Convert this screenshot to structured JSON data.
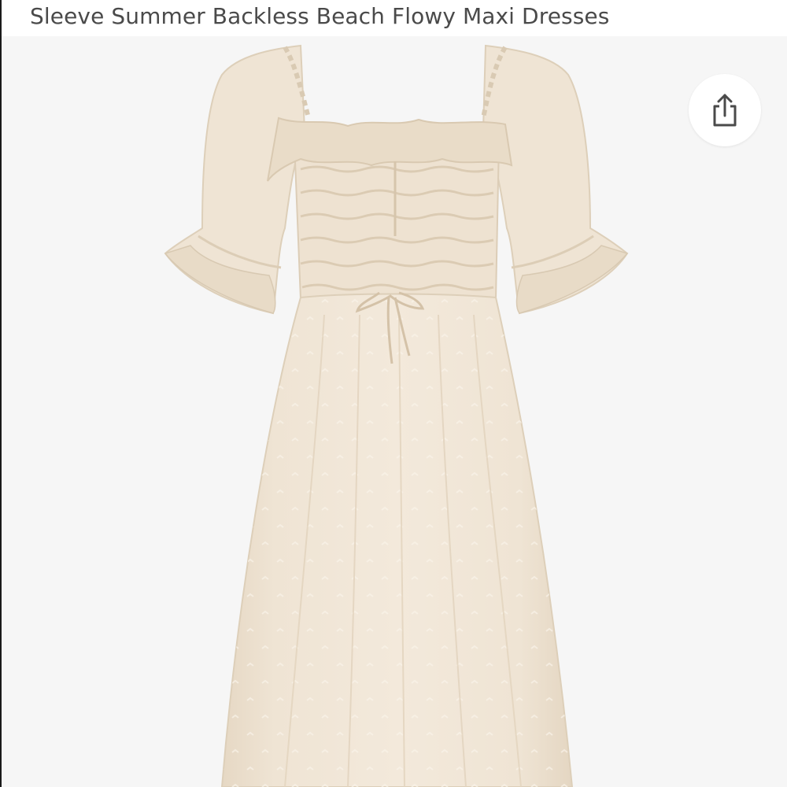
{
  "header": {
    "title": "Sleeve Summer Backless Beach Flowy Maxi Dresses"
  },
  "product_image": {
    "description_icon": "dress-image",
    "colors": {
      "background": "#f6f6f6",
      "fabric": "#efe4d4",
      "fabric_shade": "#e3d5c1",
      "fabric_highlight": "#f7efe3"
    }
  },
  "share": {
    "icon": "share-icon"
  }
}
